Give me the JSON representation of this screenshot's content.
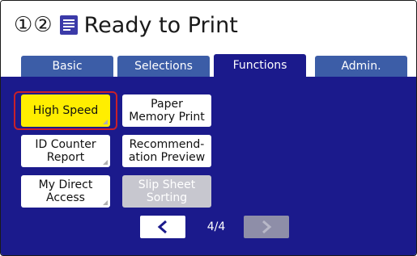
{
  "header": {
    "slots": "①②",
    "status_icon": "document-icon",
    "title": "Ready to Print"
  },
  "tabs": [
    {
      "label": "Basic",
      "active": false
    },
    {
      "label": "Selections",
      "active": false
    },
    {
      "label": "Functions",
      "active": true
    },
    {
      "label": "Admin.",
      "active": false
    }
  ],
  "functions": {
    "buttons": [
      {
        "label": "High Speed",
        "state": "active"
      },
      {
        "label": "Paper\nMemory Print",
        "state": "normal"
      },
      {
        "label": "ID Counter\nReport",
        "state": "normal"
      },
      {
        "label": "Recommend-\nation Preview",
        "state": "normal"
      },
      {
        "label": "My Direct\nAccess",
        "state": "normal"
      },
      {
        "label": "Slip Sheet\nSorting",
        "state": "disabled"
      }
    ]
  },
  "pager": {
    "page": "4/4",
    "prev_icon": "chevron-left-icon",
    "next_icon": "chevron-right-icon",
    "next_enabled": false
  },
  "colors": {
    "panel_bg": "#1b1a8c",
    "tab_inactive": "#3c5da7",
    "active_button": "#ffee00",
    "highlight_ring": "#c8202a",
    "disabled_button": "#c7c7cf"
  }
}
